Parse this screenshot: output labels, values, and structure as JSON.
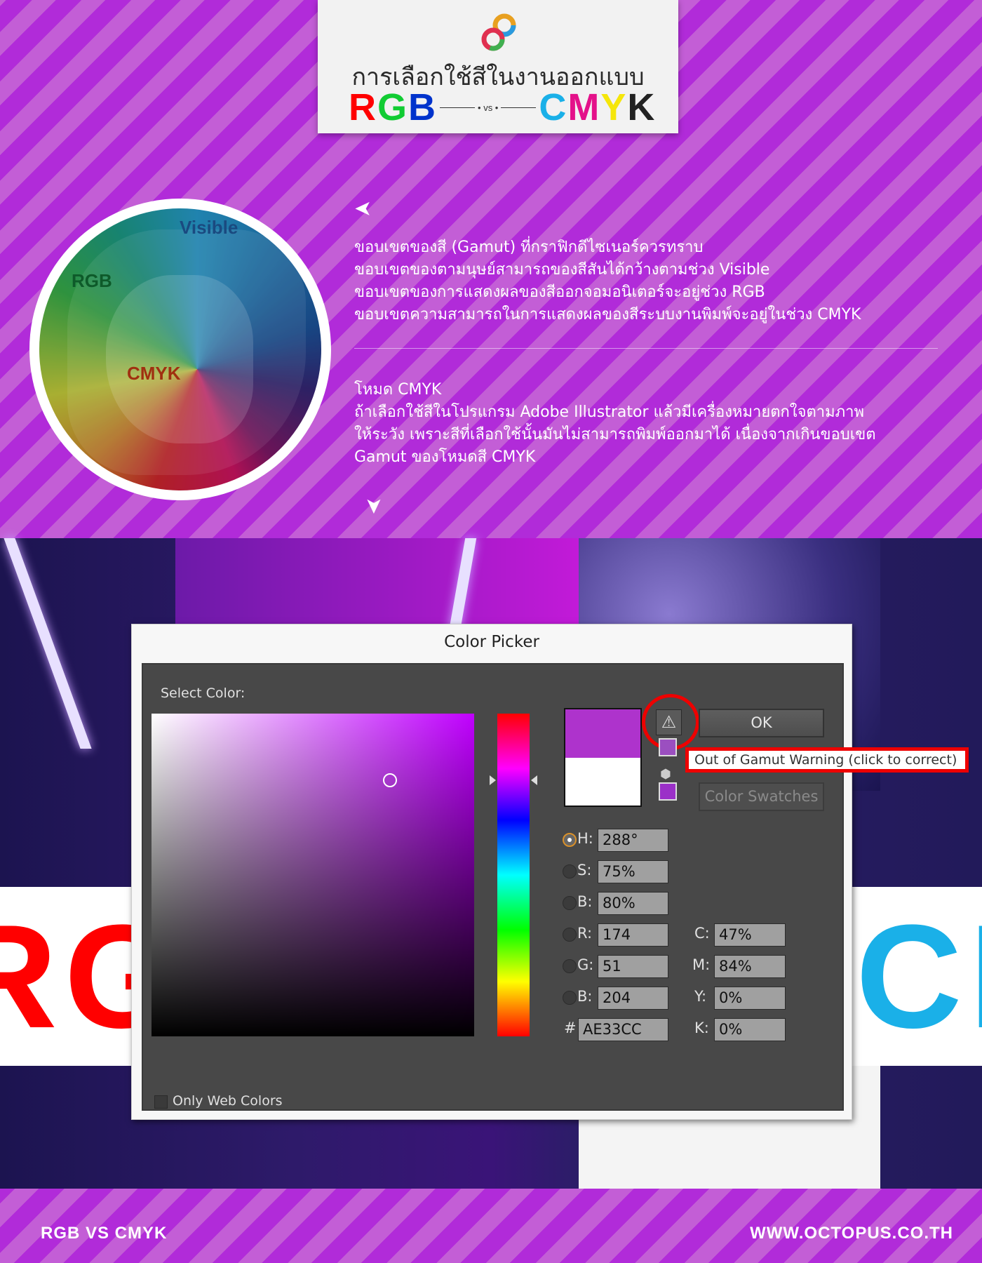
{
  "header": {
    "title_th": "การเลือกใช้สีในงานออกแบบ",
    "rgb_letters": [
      "R",
      "G",
      "B"
    ],
    "cmyk_letters": [
      "C",
      "M",
      "Y",
      "K"
    ],
    "vs": "vs"
  },
  "gamut_diagram": {
    "labels": {
      "visible": "Visible",
      "rgb": "RGB",
      "cmyk": "CMYK"
    }
  },
  "info": {
    "block1": [
      "ขอบเขตของสี (Gamut) ที่กราฟิกดีไซเนอร์ควรทราบ",
      "ขอบเขตของตามนุษย์สามารถของสีสันได้กว้างตามช่วง Visible",
      "ขอบเขตของการแสดงผลของสีออกจอมอนิเตอร์จะอยู่ช่วง RGB",
      "ขอบเขตความสามารถในการแสดงผลของสีระบบงานพิมพ์จะอยู่ในช่วง CMYK"
    ],
    "block2": [
      "โหมด CMYK",
      "ถ้าเลือกใช้สีในโปรแกรม Adobe Illustrator แล้วมีเครื่องหมายตกใจตามภาพ",
      "ให้ระวัง เพราะสีที่เลือกใช้นั้นมันไม่สามารถพิมพ์ออกมาได้ เนื่องจากเกินขอบเขต",
      "Gamut ของโหมดสี CMYK"
    ]
  },
  "banner": {
    "left": "RG",
    "right": "CM"
  },
  "dialog": {
    "title": "Color Picker",
    "select_color_label": "Select Color:",
    "ok_label": "OK",
    "swatches_label": "Color Swatches",
    "tooltip": "Out of Gamut Warning (click to correct)",
    "warning_icon": "warning-triangle-icon",
    "only_web_colors": "Only Web Colors",
    "selected_mode": "H",
    "fields": {
      "H": "288°",
      "S": "75%",
      "B": "80%",
      "R": "174",
      "G": "51",
      "Bv": "204",
      "hex": "AE33CC",
      "C": "47%",
      "M": "84%",
      "Y": "0%",
      "K": "0%"
    },
    "labels": {
      "H": "H:",
      "S": "S:",
      "B": "B:",
      "R": "R:",
      "G": "G:",
      "Bv": "B:",
      "hex": "#",
      "C": "C:",
      "M": "M:",
      "Y": "Y:",
      "K": "K:"
    },
    "new_color": "#ae33cc",
    "old_color": "#ffffff",
    "gamut_color": "#9b30c8"
  },
  "footer": {
    "left": "RGB VS CMYK",
    "right": "WWW.OCTOPUS.CO.TH"
  },
  "colors": {
    "accent": "#b12fd6",
    "warning_red": "#e00000"
  }
}
